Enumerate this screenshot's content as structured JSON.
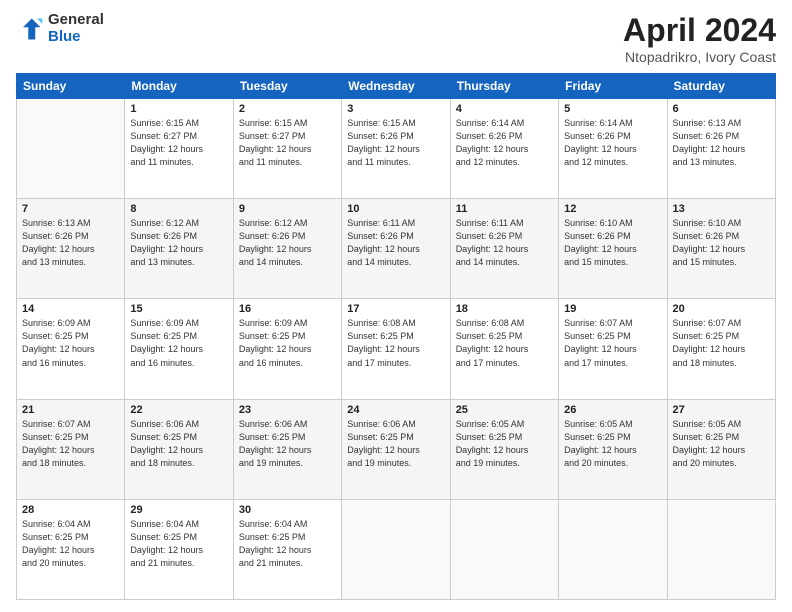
{
  "header": {
    "logo_general": "General",
    "logo_blue": "Blue",
    "title": "April 2024",
    "location": "Ntopadrikro, Ivory Coast"
  },
  "weekdays": [
    "Sunday",
    "Monday",
    "Tuesday",
    "Wednesday",
    "Thursday",
    "Friday",
    "Saturday"
  ],
  "weeks": [
    [
      {
        "day": "",
        "info": ""
      },
      {
        "day": "1",
        "info": "Sunrise: 6:15 AM\nSunset: 6:27 PM\nDaylight: 12 hours\nand 11 minutes."
      },
      {
        "day": "2",
        "info": "Sunrise: 6:15 AM\nSunset: 6:27 PM\nDaylight: 12 hours\nand 11 minutes."
      },
      {
        "day": "3",
        "info": "Sunrise: 6:15 AM\nSunset: 6:26 PM\nDaylight: 12 hours\nand 11 minutes."
      },
      {
        "day": "4",
        "info": "Sunrise: 6:14 AM\nSunset: 6:26 PM\nDaylight: 12 hours\nand 12 minutes."
      },
      {
        "day": "5",
        "info": "Sunrise: 6:14 AM\nSunset: 6:26 PM\nDaylight: 12 hours\nand 12 minutes."
      },
      {
        "day": "6",
        "info": "Sunrise: 6:13 AM\nSunset: 6:26 PM\nDaylight: 12 hours\nand 13 minutes."
      }
    ],
    [
      {
        "day": "7",
        "info": "Sunrise: 6:13 AM\nSunset: 6:26 PM\nDaylight: 12 hours\nand 13 minutes."
      },
      {
        "day": "8",
        "info": "Sunrise: 6:12 AM\nSunset: 6:26 PM\nDaylight: 12 hours\nand 13 minutes."
      },
      {
        "day": "9",
        "info": "Sunrise: 6:12 AM\nSunset: 6:26 PM\nDaylight: 12 hours\nand 14 minutes."
      },
      {
        "day": "10",
        "info": "Sunrise: 6:11 AM\nSunset: 6:26 PM\nDaylight: 12 hours\nand 14 minutes."
      },
      {
        "day": "11",
        "info": "Sunrise: 6:11 AM\nSunset: 6:26 PM\nDaylight: 12 hours\nand 14 minutes."
      },
      {
        "day": "12",
        "info": "Sunrise: 6:10 AM\nSunset: 6:26 PM\nDaylight: 12 hours\nand 15 minutes."
      },
      {
        "day": "13",
        "info": "Sunrise: 6:10 AM\nSunset: 6:26 PM\nDaylight: 12 hours\nand 15 minutes."
      }
    ],
    [
      {
        "day": "14",
        "info": "Sunrise: 6:09 AM\nSunset: 6:25 PM\nDaylight: 12 hours\nand 16 minutes."
      },
      {
        "day": "15",
        "info": "Sunrise: 6:09 AM\nSunset: 6:25 PM\nDaylight: 12 hours\nand 16 minutes."
      },
      {
        "day": "16",
        "info": "Sunrise: 6:09 AM\nSunset: 6:25 PM\nDaylight: 12 hours\nand 16 minutes."
      },
      {
        "day": "17",
        "info": "Sunrise: 6:08 AM\nSunset: 6:25 PM\nDaylight: 12 hours\nand 17 minutes."
      },
      {
        "day": "18",
        "info": "Sunrise: 6:08 AM\nSunset: 6:25 PM\nDaylight: 12 hours\nand 17 minutes."
      },
      {
        "day": "19",
        "info": "Sunrise: 6:07 AM\nSunset: 6:25 PM\nDaylight: 12 hours\nand 17 minutes."
      },
      {
        "day": "20",
        "info": "Sunrise: 6:07 AM\nSunset: 6:25 PM\nDaylight: 12 hours\nand 18 minutes."
      }
    ],
    [
      {
        "day": "21",
        "info": "Sunrise: 6:07 AM\nSunset: 6:25 PM\nDaylight: 12 hours\nand 18 minutes."
      },
      {
        "day": "22",
        "info": "Sunrise: 6:06 AM\nSunset: 6:25 PM\nDaylight: 12 hours\nand 18 minutes."
      },
      {
        "day": "23",
        "info": "Sunrise: 6:06 AM\nSunset: 6:25 PM\nDaylight: 12 hours\nand 19 minutes."
      },
      {
        "day": "24",
        "info": "Sunrise: 6:06 AM\nSunset: 6:25 PM\nDaylight: 12 hours\nand 19 minutes."
      },
      {
        "day": "25",
        "info": "Sunrise: 6:05 AM\nSunset: 6:25 PM\nDaylight: 12 hours\nand 19 minutes."
      },
      {
        "day": "26",
        "info": "Sunrise: 6:05 AM\nSunset: 6:25 PM\nDaylight: 12 hours\nand 20 minutes."
      },
      {
        "day": "27",
        "info": "Sunrise: 6:05 AM\nSunset: 6:25 PM\nDaylight: 12 hours\nand 20 minutes."
      }
    ],
    [
      {
        "day": "28",
        "info": "Sunrise: 6:04 AM\nSunset: 6:25 PM\nDaylight: 12 hours\nand 20 minutes."
      },
      {
        "day": "29",
        "info": "Sunrise: 6:04 AM\nSunset: 6:25 PM\nDaylight: 12 hours\nand 21 minutes."
      },
      {
        "day": "30",
        "info": "Sunrise: 6:04 AM\nSunset: 6:25 PM\nDaylight: 12 hours\nand 21 minutes."
      },
      {
        "day": "",
        "info": ""
      },
      {
        "day": "",
        "info": ""
      },
      {
        "day": "",
        "info": ""
      },
      {
        "day": "",
        "info": ""
      }
    ]
  ]
}
